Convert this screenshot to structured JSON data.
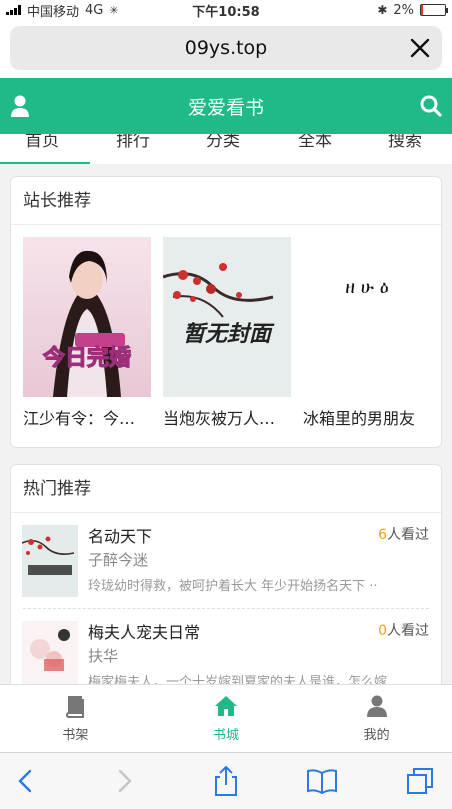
{
  "status_bar": {
    "carrier": "中国移动",
    "network": "4G",
    "time": "下午10:58",
    "battery_percent": "2%",
    "battery_level": 0.02
  },
  "url_bar": {
    "url": "09ys.top"
  },
  "header": {
    "title": "爱爱看书"
  },
  "tabs": [
    {
      "label": "首页",
      "active": true
    },
    {
      "label": "排行"
    },
    {
      "label": "分类"
    },
    {
      "label": "全本"
    },
    {
      "label": "搜索"
    }
  ],
  "recommend": {
    "title": "站长推荐",
    "books": [
      {
        "title": "江少有令：今…",
        "cover_text": "今日完婚"
      },
      {
        "title": "当炮灰被万人…",
        "cover_text": "暂无封面"
      },
      {
        "title": "冰箱里的男朋友",
        "cover_text": "ዘ ሁ ዕ"
      }
    ]
  },
  "hot": {
    "title": "热门推荐",
    "items": [
      {
        "name": "名动天下",
        "views_num": "6",
        "views_suffix": "人看过",
        "author": "子醉今迷",
        "desc": "玲珑幼时得救，被呵护着长大 年少开始扬名天下 ··"
      },
      {
        "name": "梅夫人宠夫日常",
        "views_num": "0",
        "views_suffix": "人看过",
        "author": "扶华",
        "desc": "梅家梅夫人，一个十岁嫁到夏家的夫人是谁，怎么嫁"
      }
    ]
  },
  "bottom_nav": [
    {
      "label": "书架",
      "icon": "book-icon"
    },
    {
      "label": "书城",
      "icon": "home-icon",
      "active": true
    },
    {
      "label": "我的",
      "icon": "user-icon"
    }
  ],
  "colors": {
    "accent": "#1fb98a",
    "views_highlight": "#f0a020"
  }
}
